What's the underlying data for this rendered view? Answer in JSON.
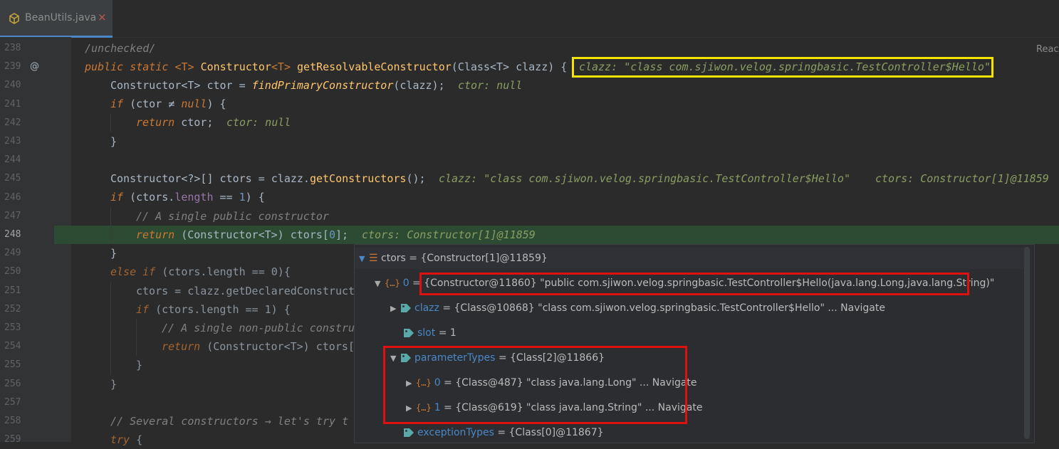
{
  "tab": {
    "label": "BeanUtils.java",
    "close": "×"
  },
  "reader_mode": "Reac",
  "line_numbers": [
    "238",
    "239",
    "240",
    "241",
    "242",
    "243",
    "244",
    "245",
    "246",
    "247",
    "248",
    "249",
    "250",
    "251",
    "252",
    "253",
    "254",
    "255",
    "256",
    "257",
    "258",
    "259"
  ],
  "code": {
    "l238": "/unchecked/",
    "l239_mod": "public static ",
    "l239_gen": "<T> ",
    "l239_type": "Constructor",
    "l239_gen2": "<T> ",
    "l239_fn": "getResolvableConstructor",
    "l239_args": "(Class<T> clazz) {",
    "l239_inline": "clazz: \"class com.sjiwon.velog.springbasic.TestController$Hello\"",
    "l240_a": "Constructor<T> ctor = ",
    "l240_fn": "findPrimaryConstructor",
    "l240_b": "(clazz);",
    "l240_inline": "ctor: null",
    "l241_kw": "if ",
    "l241_a": "(ctor ≠ ",
    "l241_null": "null",
    "l241_b": ") {",
    "l242_kw": "return ",
    "l242_a": "ctor;",
    "l242_inline": "ctor: null",
    "l243": "}",
    "l245_a": "Constructor<?>[] ctors = clazz.",
    "l245_fn": "getConstructors",
    "l245_b": "();",
    "l245_inline1": "clazz: \"class com.sjiwon.velog.springbasic.TestController$Hello\"",
    "l245_inline2": "ctors: Constructor[1]@11859",
    "l246_kw": "if ",
    "l246_a": "(ctors.",
    "l246_fld": "length",
    "l246_b": " == ",
    "l246_num": "1",
    "l246_c": ") {",
    "l247": "// A single public constructor",
    "l248_kw": "return ",
    "l248_a": "(Constructor<T>) ctors[",
    "l248_num": "0",
    "l248_b": "];",
    "l248_inline": "ctors: Constructor[1]@11859",
    "l249": "}",
    "l250_kw": "else if ",
    "l250_a": "(ctors.length == 0){",
    "l251": "ctors = clazz.getDeclaredConstruct",
    "l252_kw": "if ",
    "l252_a": "(ctors.length == 1) {",
    "l253": "// A single non-public constru",
    "l254_kw": "return ",
    "l254_a": "(Constructor<T>) ctors[",
    "l255": "}",
    "l256": "}",
    "l258": "// Several constructors → let's try t",
    "l259_kw": "try ",
    "l259_a": "{"
  },
  "debug": {
    "root": "ctors = {Constructor[1]@11859}",
    "item0_key": "0",
    "item0_val": "{Constructor@11860} \"public com.sjiwon.velog.springbasic.TestController$Hello(java.lang.Long,java.lang.String)\"",
    "clazz_key": "clazz",
    "clazz_val": " = {Class@10868} \"class com.sjiwon.velog.springbasic.TestController$Hello\" ... ",
    "clazz_nav": "Navigate",
    "slot_key": "slot",
    "slot_val": " = 1",
    "pt_key": "parameterTypes",
    "pt_val": " = {Class[2]@11866}",
    "pt0_key": "0",
    "pt0_val": " = {Class@487} \"class java.lang.Long\" ... ",
    "pt0_nav": "Navigate",
    "pt1_key": "1",
    "pt1_val": " = {Class@619} \"class java.lang.String\" ... ",
    "pt1_nav": "Navigate",
    "et_key": "exceptionTypes",
    "et_val": " = {Class[0]@11867}",
    "eq": " = "
  },
  "colors": {
    "highlight_line": "#2d4a33",
    "yellow_box": "#f5e400",
    "red_box": "#e01010"
  }
}
